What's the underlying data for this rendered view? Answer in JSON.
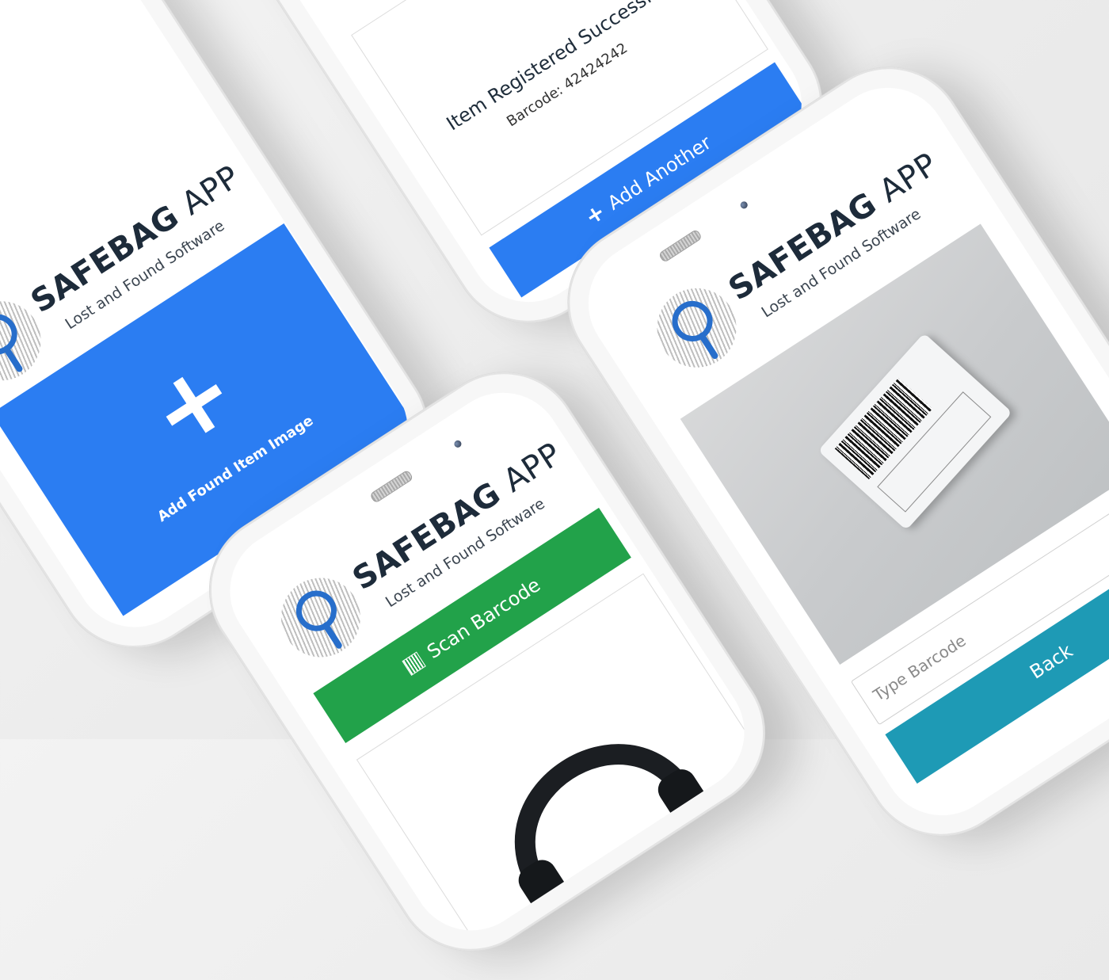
{
  "app": {
    "brand_bold": "SAFEBAG",
    "brand_app": "APP",
    "tagline": "Lost and Found Software"
  },
  "screen_add_image": {
    "panel_label": "Add Found Item Image",
    "plus_glyph": "+",
    "panel_color": "#2b7df2"
  },
  "screen_success": {
    "title": "Item Registered Successfully",
    "barcode_label": "Barcode: 42424242",
    "add_another_label": "Add Another",
    "button_icon": "+",
    "button_color": "#2b7df2",
    "check_color": "#22a24a"
  },
  "screen_scan": {
    "scan_label": "Scan Barcode",
    "scan_icon": "barcode-icon",
    "button_color": "#22a24a"
  },
  "screen_barcode": {
    "type_barcode_placeholder": "Type Barcode",
    "back_label": "Back",
    "back_color": "#1e9ab5"
  }
}
